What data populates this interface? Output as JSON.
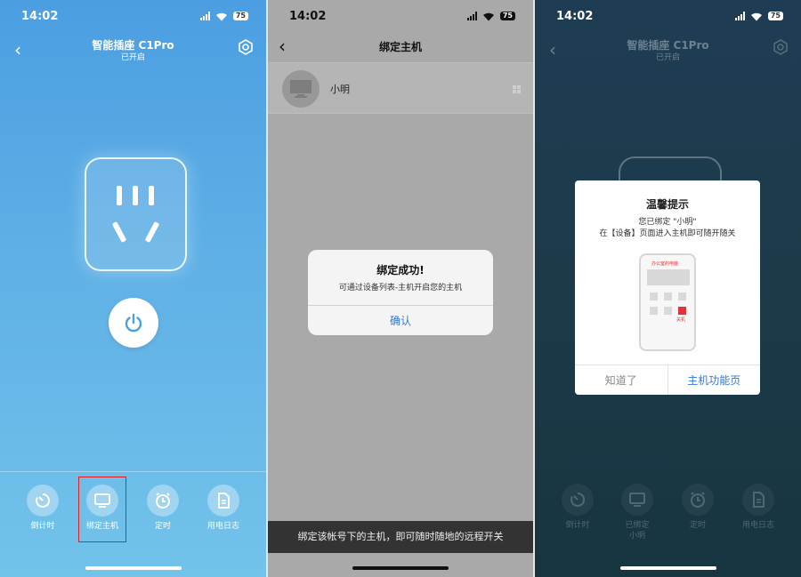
{
  "status": {
    "time": "14:02",
    "battery": "75"
  },
  "screen1": {
    "title": "智能插座 C1Pro",
    "subtitle": "已开启",
    "bottom": [
      "倒计时",
      "绑定主机",
      "定时",
      "用电日志"
    ]
  },
  "screen2": {
    "title": "绑定主机",
    "host_name": "小明",
    "alert": {
      "title": "绑定成功!",
      "message": "可通过设备列表-主机开启您的主机",
      "confirm": "确认"
    },
    "toast": "绑定该帐号下的主机，即可随时随地的远程开关"
  },
  "screen3": {
    "title": "智能插座 C1Pro",
    "subtitle": "已开启",
    "bottom": [
      "倒计时",
      "已绑定\n小明",
      "定时",
      "用电日志"
    ],
    "modal": {
      "title": "温馨提示",
      "line1": "您已绑定 \"小明\"",
      "line2": "在【设备】页面进入主机即可随开随关",
      "phone_title": "办公室的电脑",
      "phone_off": "关机",
      "btn_left": "知道了",
      "btn_right": "主机功能页"
    }
  },
  "colors": {
    "accent": "#3478d6",
    "alert_red": "#e0333a",
    "highlight": "#e02020"
  }
}
